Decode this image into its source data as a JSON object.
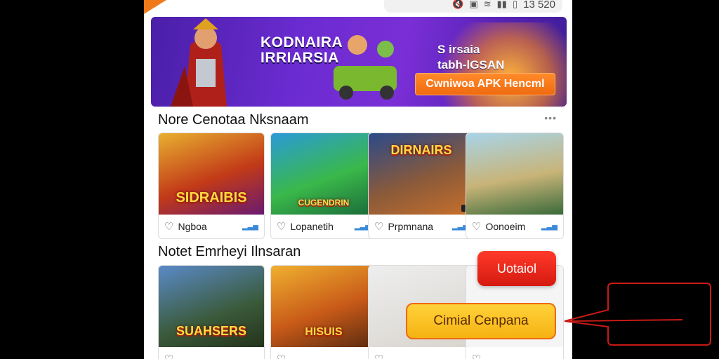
{
  "status_bar": {
    "time": "13 520",
    "icons": [
      "mute-icon",
      "sim-icon",
      "wifi-icon",
      "signal-icon",
      "battery-icon"
    ]
  },
  "banner": {
    "title_line1": "KODNAIRA",
    "title_line2": "IRRIARSIA",
    "subtitle_line1": "S irsaia",
    "subtitle_line2": "tabh-lGSAN",
    "cta_label": "Cwniwoa APK Hencml",
    "colors": {
      "bg_start": "#4a1fa8",
      "cta": "#f06a10"
    }
  },
  "section1": {
    "title": "Nore Cenotaa Nksnaam",
    "more_icon": "more-dots-icon",
    "games": [
      {
        "title": "Ngboa",
        "thumb_text": "SIDRAIBIS"
      },
      {
        "title": "Lopanetih",
        "thumb_text": "CUGENDRIN"
      },
      {
        "title": "Prpmnana",
        "thumb_text": "DIRNAIRS"
      },
      {
        "title": "Oonoeim",
        "thumb_text": ""
      }
    ]
  },
  "section2": {
    "title": "Notet Emrheyi Ilnsaran",
    "games": [
      {
        "title": "",
        "thumb_text": "SUAHSERS"
      },
      {
        "title": "",
        "thumb_text": "HISUIS"
      },
      {
        "title": "",
        "thumb_text": ""
      },
      {
        "title": "",
        "thumb_text": ""
      }
    ]
  },
  "actions": {
    "primary_label": "Uotaiol",
    "secondary_label": "Cimial Cenpana"
  }
}
